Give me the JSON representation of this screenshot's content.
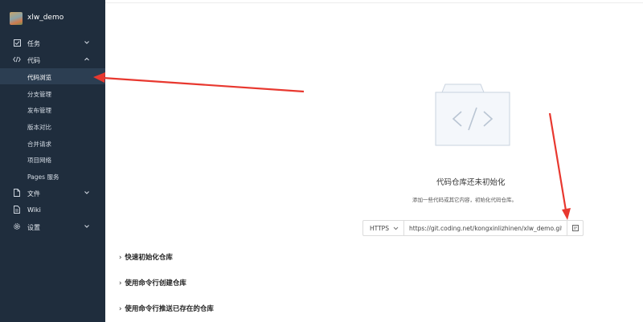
{
  "project": {
    "name": "xlw_demo"
  },
  "nav": {
    "tasks": "任务",
    "code": "代码",
    "code_sub": [
      "代码浏览",
      "分支管理",
      "发布管理",
      "版本对比",
      "合并请求",
      "项目网络",
      "Pages 服务"
    ],
    "files": "文件",
    "wiki": "Wiki",
    "settings": "设置"
  },
  "empty": {
    "title": "代码仓库还未初始化",
    "desc": "添加一些代码或其它内容，初始化代码仓库。"
  },
  "clone": {
    "protocol": "HTTPS",
    "url": "https://git.coding.net/kongxinlizhinen/xlw_demo.git"
  },
  "sections": [
    "快速初始化仓库",
    "使用命令行创建仓库",
    "使用命令行推送已存在的仓库"
  ],
  "colors": {
    "sidebar_bg": "#1f2d3d",
    "active_bg": "#2c3e52",
    "annotation_red": "#e8382f"
  },
  "icons": {
    "tasks": "checkbox-icon",
    "code": "code-brackets-icon",
    "files": "file-icon",
    "wiki": "document-icon",
    "settings": "gear-icon",
    "copy": "copy-icon"
  }
}
